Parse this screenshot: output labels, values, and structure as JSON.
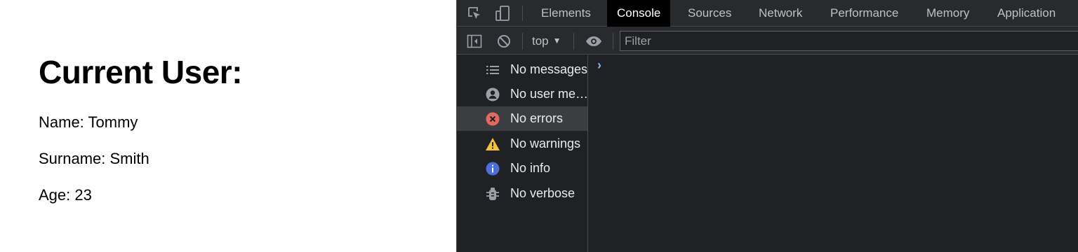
{
  "page": {
    "heading": "Current User:",
    "name_line": "Name: Tommy",
    "surname_line": "Surname: Smith",
    "age_line": "Age: 23"
  },
  "devtools": {
    "tabs": [
      "Elements",
      "Console",
      "Sources",
      "Network",
      "Performance",
      "Memory",
      "Application"
    ],
    "active_tab": "Console",
    "context_selector": "top",
    "filter_placeholder": "Filter",
    "sidebar": [
      {
        "label": "No messages",
        "icon": "list-icon"
      },
      {
        "label": "No user me…",
        "icon": "user-icon"
      },
      {
        "label": "No errors",
        "icon": "error-icon",
        "selected": true
      },
      {
        "label": "No warnings",
        "icon": "warning-icon"
      },
      {
        "label": "No info",
        "icon": "info-icon"
      },
      {
        "label": "No verbose",
        "icon": "verbose-bug-icon"
      }
    ],
    "prompt_symbol": "›",
    "colors": {
      "background": "#202124",
      "toolbar": "#292a2d",
      "active_tab": "#000000",
      "error": "#e46962",
      "warning": "#f2c43d",
      "info": "#4c6ed9",
      "prompt": "#8ab4f8"
    }
  }
}
